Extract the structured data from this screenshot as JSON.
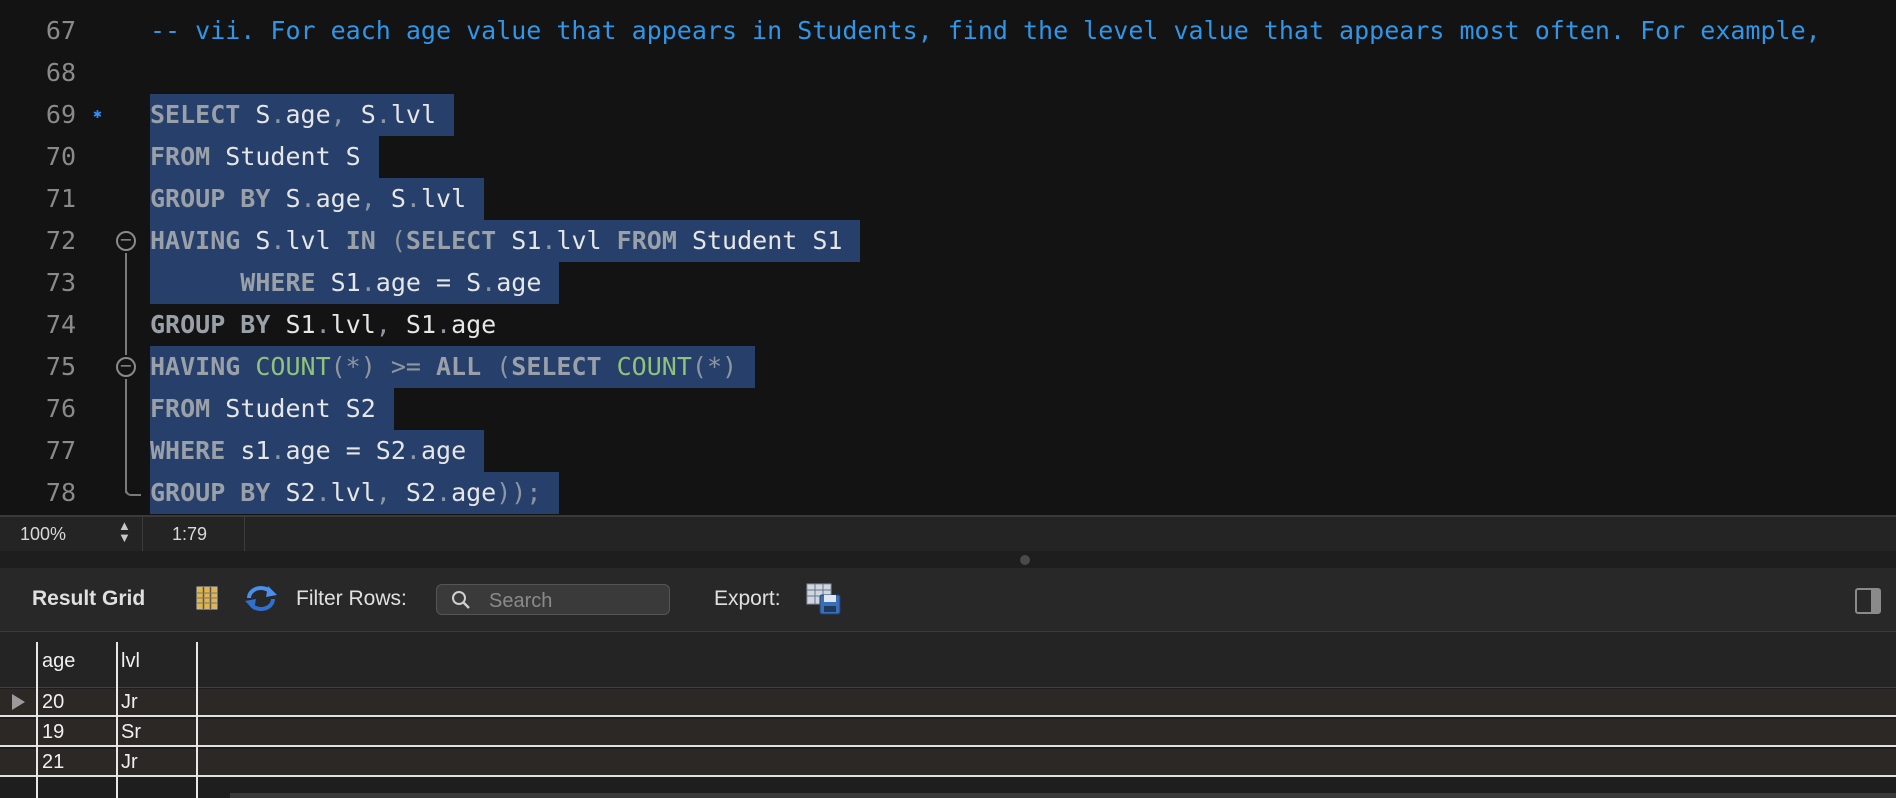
{
  "editor": {
    "lines": [
      {
        "num": "67",
        "tokens": [
          {
            "t": "-- vii. For each age value that appears in Students, find the level value that appears most often. For example,",
            "c": "cm"
          }
        ],
        "selected": false
      },
      {
        "num": "68",
        "tokens": [],
        "selected": false
      },
      {
        "num": "69",
        "tokens": [
          {
            "t": "SELECT",
            "c": "kw"
          },
          {
            "t": " S",
            "c": ""
          },
          {
            "t": ".",
            "c": "pu"
          },
          {
            "t": "age",
            "c": ""
          },
          {
            "t": ",",
            "c": "pu"
          },
          {
            "t": " S",
            "c": ""
          },
          {
            "t": ".",
            "c": "pu"
          },
          {
            "t": "lvl",
            "c": ""
          }
        ],
        "selected": true
      },
      {
        "num": "70",
        "tokens": [
          {
            "t": "FROM",
            "c": "kw"
          },
          {
            "t": " Student S",
            "c": ""
          }
        ],
        "selected": true
      },
      {
        "num": "71",
        "tokens": [
          {
            "t": "GROUP BY",
            "c": "kw"
          },
          {
            "t": " S",
            "c": ""
          },
          {
            "t": ".",
            "c": "pu"
          },
          {
            "t": "age",
            "c": ""
          },
          {
            "t": ",",
            "c": "pu"
          },
          {
            "t": " S",
            "c": ""
          },
          {
            "t": ".",
            "c": "pu"
          },
          {
            "t": "lvl",
            "c": ""
          }
        ],
        "selected": true
      },
      {
        "num": "72",
        "tokens": [
          {
            "t": "HAVING",
            "c": "kw"
          },
          {
            "t": " S",
            "c": ""
          },
          {
            "t": ".",
            "c": "pu"
          },
          {
            "t": "lvl ",
            "c": ""
          },
          {
            "t": "IN",
            "c": "kw"
          },
          {
            "t": " (",
            "c": "pu"
          },
          {
            "t": "SELECT",
            "c": "kw"
          },
          {
            "t": " S1",
            "c": ""
          },
          {
            "t": ".",
            "c": "pu"
          },
          {
            "t": "lvl ",
            "c": ""
          },
          {
            "t": "FROM",
            "c": "kw"
          },
          {
            "t": " Student S1",
            "c": ""
          }
        ],
        "selected": true
      },
      {
        "num": "73",
        "tokens": [
          {
            "t": "      WHERE",
            "c": "kw"
          },
          {
            "t": " S1",
            "c": ""
          },
          {
            "t": ".",
            "c": "pu"
          },
          {
            "t": "age = S",
            "c": ""
          },
          {
            "t": ".",
            "c": "pu"
          },
          {
            "t": "age",
            "c": ""
          }
        ],
        "selected": true
      },
      {
        "num": "74",
        "tokens": [
          {
            "t": "GROUP BY",
            "c": "kw"
          },
          {
            "t": " S1",
            "c": ""
          },
          {
            "t": ".",
            "c": "pu"
          },
          {
            "t": "lvl",
            "c": ""
          },
          {
            "t": ",",
            "c": "pu"
          },
          {
            "t": " S1",
            "c": ""
          },
          {
            "t": ".",
            "c": "pu"
          },
          {
            "t": "age",
            "c": ""
          }
        ],
        "selected": false
      },
      {
        "num": "75",
        "tokens": [
          {
            "t": "HAVING",
            "c": "kw"
          },
          {
            "t": " COUNT",
            "c": "fn"
          },
          {
            "t": "(*)",
            "c": "pu"
          },
          {
            "t": " >= ",
            "c": "pu"
          },
          {
            "t": "ALL",
            "c": "kw"
          },
          {
            "t": " (",
            "c": "pu"
          },
          {
            "t": "SELECT",
            "c": "kw"
          },
          {
            "t": " COUNT",
            "c": "fn"
          },
          {
            "t": "(*)",
            "c": "pu"
          }
        ],
        "selected": true
      },
      {
        "num": "76",
        "tokens": [
          {
            "t": "FROM",
            "c": "kw"
          },
          {
            "t": " Student S2",
            "c": ""
          }
        ],
        "selected": true
      },
      {
        "num": "77",
        "tokens": [
          {
            "t": "WHERE",
            "c": "kw"
          },
          {
            "t": " s1",
            "c": ""
          },
          {
            "t": ".",
            "c": "pu"
          },
          {
            "t": "age = S2",
            "c": ""
          },
          {
            "t": ".",
            "c": "pu"
          },
          {
            "t": "age",
            "c": ""
          }
        ],
        "selected": true
      },
      {
        "num": "78",
        "tokens": [
          {
            "t": "GROUP BY",
            "c": "kw"
          },
          {
            "t": " S2",
            "c": ""
          },
          {
            "t": ".",
            "c": "pu"
          },
          {
            "t": "lvl",
            "c": ""
          },
          {
            "t": ",",
            "c": "pu"
          },
          {
            "t": " S2",
            "c": ""
          },
          {
            "t": ".",
            "c": "pu"
          },
          {
            "t": "age",
            "c": ""
          },
          {
            "t": "));",
            "c": "pu"
          }
        ],
        "selected": true
      }
    ],
    "statement_marker_line": "69",
    "fold_lines": [
      "72",
      "75"
    ]
  },
  "status": {
    "zoom": "100%",
    "cursor_position": "1:79"
  },
  "results": {
    "title": "Result Grid",
    "filter_label": "Filter Rows:",
    "search_placeholder": "Search",
    "export_label": "Export:",
    "columns": [
      "age",
      "lvl"
    ],
    "rows": [
      [
        "20",
        "Jr"
      ],
      [
        "19",
        "Sr"
      ],
      [
        "21",
        "Jr"
      ]
    ],
    "current_row": 0
  },
  "icons": {
    "statement": "statement-marker-icon",
    "fold": "fold-collapse-icon",
    "grid_view": "grid-view-icon",
    "refresh": "refresh-icon",
    "search": "search-icon",
    "export": "export-icon",
    "panel": "panel-toggle-icon",
    "row_pointer": "current-row-arrow-icon"
  },
  "colors": {
    "selection": "#27406b",
    "comment": "#2f96e8",
    "keyword": "#9aa0a8",
    "function": "#8fc27a"
  }
}
